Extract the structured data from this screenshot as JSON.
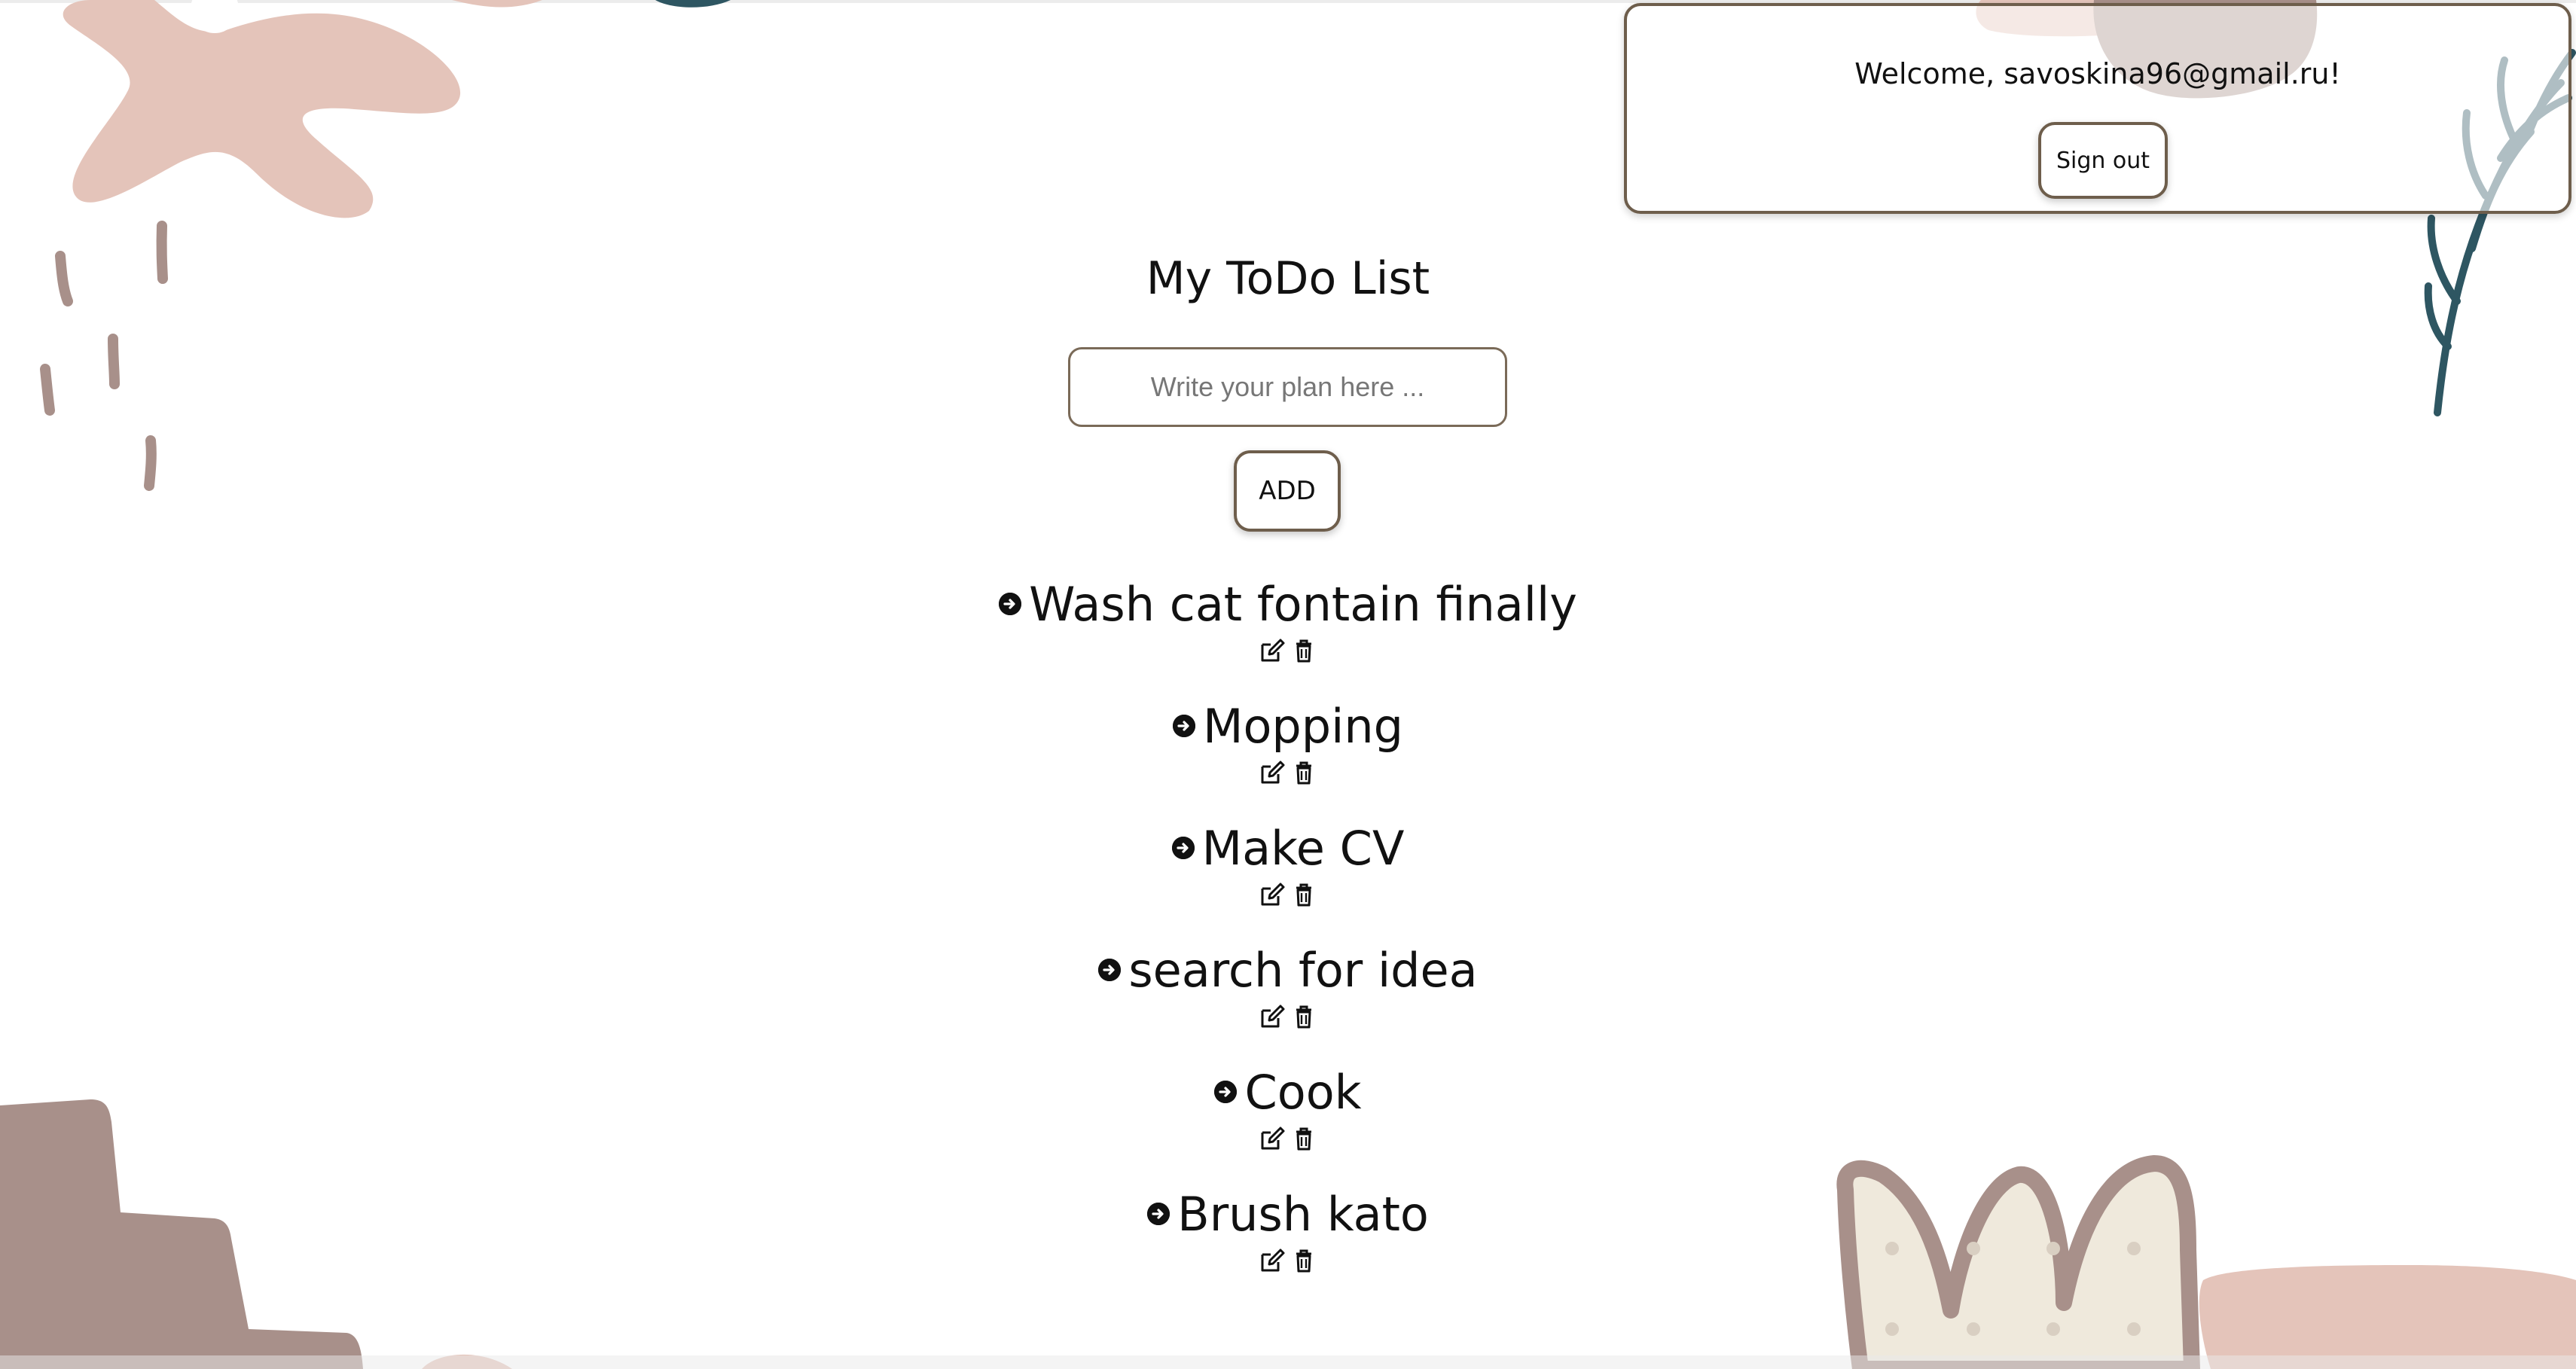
{
  "header": {
    "welcome_text": "Welcome, savoskina96@gmail.ru!",
    "sign_out_label": "Sign out"
  },
  "main": {
    "title": "My ToDo List",
    "input": {
      "placeholder": "Write your plan here ...",
      "value": ""
    },
    "add_label": "ADD"
  },
  "todos": [
    {
      "text": "Wash cat fontain finally"
    },
    {
      "text": "Mopping"
    },
    {
      "text": "Make CV"
    },
    {
      "text": "search for idea"
    },
    {
      "text": "Cook"
    },
    {
      "text": "Brush kato"
    }
  ],
  "icons": {
    "bullet": "circle-arrow-right-icon",
    "edit": "edit-icon",
    "delete": "trash-icon"
  },
  "colors": {
    "border": "#6e5e4c",
    "blush": "#e4c4ba",
    "mauve": "#a8908a",
    "teal": "#2e5662",
    "cream": "#efe9dc"
  }
}
